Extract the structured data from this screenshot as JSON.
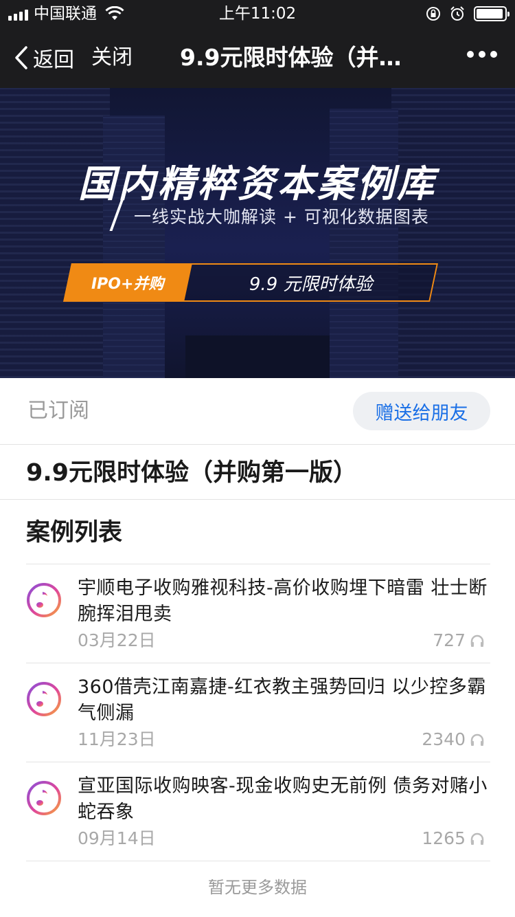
{
  "status_bar": {
    "carrier": "中国联通",
    "time": "上午11:02",
    "battery_level": 0.95
  },
  "nav": {
    "back_label": "返回",
    "close_label": "关闭",
    "title": "9.9元限时体验（并…"
  },
  "banner": {
    "title": "国内精粹资本案例库",
    "subtitle": "一线实战大咖解读 + 可视化数据图表",
    "promo_tag": "IPO+并购",
    "promo_text": "9.9 元限时体验",
    "accent_color": "#f08a14"
  },
  "subscribe": {
    "status_label": "已订阅",
    "gift_button_label": "赠送给朋友"
  },
  "product_title": "9.9元限时体验（并购第一版）",
  "list_heading": "案例列表",
  "cases": [
    {
      "title": "宇顺电子收购雅视科技-高价收购埋下暗雷 壮士断腕挥泪甩卖",
      "date": "03月22日",
      "plays": "727"
    },
    {
      "title": "360借壳江南嘉捷-红衣教主强势回归 以少控多霸气侧漏",
      "date": "11月23日",
      "plays": "2340"
    },
    {
      "title": "宣亚国际收购映客-现金收购史无前例 债务对赌小蛇吞象",
      "date": "09月14日",
      "plays": "1265"
    }
  ],
  "footer": {
    "no_more_label": "暂无更多数据"
  },
  "icons": {
    "audio": "music-note-icon",
    "plays": "headphone-icon",
    "back": "chevron-left-icon",
    "more": "ellipsis-icon"
  }
}
